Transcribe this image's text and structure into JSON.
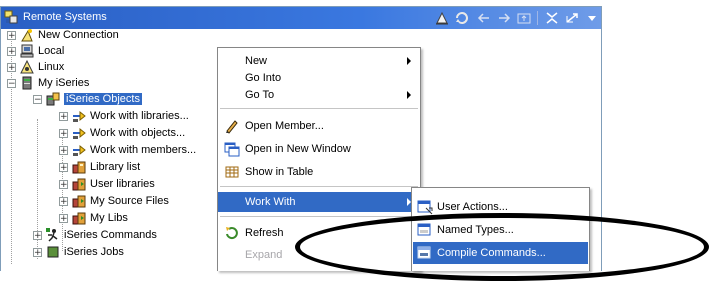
{
  "view": {
    "title": "Remote Systems"
  },
  "toolbar": [
    "link-icon",
    "refresh-icon",
    "back-arrow-icon",
    "forward-arrow-icon",
    "up-folder-icon",
    "collapse-all-icon",
    "link-with-editor-icon",
    "view-menu-icon"
  ],
  "tree": [
    {
      "label": "New Connection",
      "icon": "new-connection-icon"
    },
    {
      "label": "Local",
      "icon": "computer-icon"
    },
    {
      "label": "Linux",
      "icon": "linux-icon"
    },
    {
      "label": "My iSeries",
      "icon": "iseries-system-icon"
    },
    {
      "label": "iSeries Objects",
      "icon": "iseries-objects-icon",
      "selected": true
    },
    {
      "label": "Work with libraries...",
      "icon": "filter-arrow-icon"
    },
    {
      "label": "Work with objects...",
      "icon": "filter-arrow-icon"
    },
    {
      "label": "Work with members...",
      "icon": "filter-arrow-icon"
    },
    {
      "label": "Library list",
      "icon": "library-icon"
    },
    {
      "label": "User libraries",
      "icon": "library-icon"
    },
    {
      "label": "My Source Files",
      "icon": "library-icon"
    },
    {
      "label": "My Libs",
      "icon": "library-icon"
    },
    {
      "label": "iSeries Commands",
      "icon": "iseries-commands-icon"
    },
    {
      "label": "iSeries Jobs",
      "icon": "iseries-jobs-icon"
    }
  ],
  "context_menu": {
    "new": "New",
    "go_into": "Go Into",
    "go_to": "Go To",
    "open_member": "Open Member...",
    "open_new_window": "Open in New Window",
    "show_in_table": "Show in Table",
    "work_with": "Work With",
    "refresh": "Refresh",
    "expand": "Expand"
  },
  "submenu": {
    "user_actions": "User Actions...",
    "named_types": "Named Types...",
    "compile_commands": "Compile Commands..."
  },
  "colors": {
    "selection": "#316ac5",
    "title_bar": "#3a78e0",
    "annotation": "#000000"
  }
}
